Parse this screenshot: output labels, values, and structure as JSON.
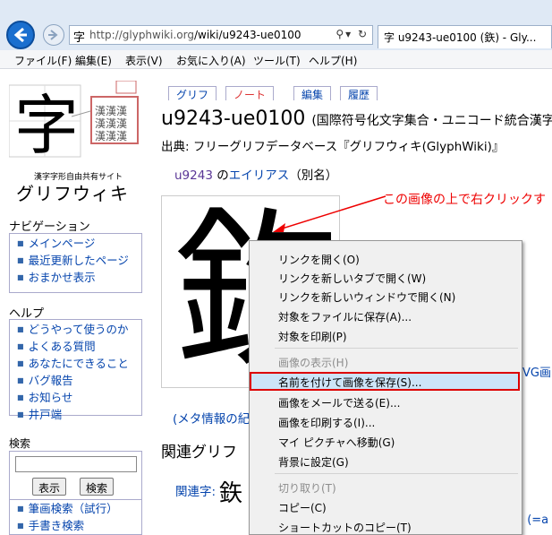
{
  "browser": {
    "url_host": "http://glyphwiki.org",
    "url_path": "/wiki/u9243-ue0100",
    "favicon": "字",
    "tab_title": "字 u9243-ue0100 (鉃) - Gly...",
    "menu": [
      "ファイル(F)",
      "編集(E)",
      "表示(V)",
      "お気に入り(A)",
      "ツール(T)",
      "ヘルプ(H)"
    ]
  },
  "logo": {
    "glyph": "字",
    "subtitle": "漢字字形自由共有サイト",
    "name": "グリフウィキ"
  },
  "page_tabs": [
    "グリフ",
    "ノート",
    "編集",
    "履歴"
  ],
  "sidebar": {
    "nav_heading": "ナビゲーション",
    "nav_items": [
      "メインページ",
      "最近更新したページ",
      "おまかせ表示"
    ],
    "help_heading": "ヘルプ",
    "help_items": [
      "どうやって使うのか",
      "よくある質問",
      "あなたにできること",
      "バグ報告",
      "お知らせ",
      "井戸端"
    ],
    "search_heading": "検索",
    "search_buttons": [
      "表示",
      "検索"
    ],
    "search_links": [
      "筆画検索（試行）",
      "手書き検索"
    ]
  },
  "main": {
    "title": "u9243-ue0100",
    "title_suffix": "(国際符号化文字集合・ユニコード統合漢字",
    "source": "出典: フリーグリフデータベース『グリフウィキ(GlyphWiki)』",
    "alias_code": "u9243",
    "alias_of": " の",
    "alias_link": "エイリアス",
    "alias_tail": "（別名）",
    "glyph": "鉃",
    "annotation": "この画像の上で右クリックす",
    "meta_link": "(メタ情報の紀",
    "related_heading": "関連グリフ",
    "related_label": "関連字:",
    "related_glyph": "鉃",
    "right_partial_1": "VG画",
    "right_partial_2": ") (=a"
  },
  "context_menu": {
    "items": [
      {
        "label": "リンクを開く(O)",
        "disabled": false
      },
      {
        "label": "リンクを新しいタブで開く(W)",
        "disabled": false
      },
      {
        "label": "リンクを新しいウィンドウで開く(N)",
        "disabled": false
      },
      {
        "label": "対象をファイルに保存(A)...",
        "disabled": false
      },
      {
        "label": "対象を印刷(P)",
        "disabled": false
      },
      {
        "label": "画像の表示(H)",
        "disabled": true
      },
      {
        "label": "名前を付けて画像を保存(S)...",
        "disabled": false
      },
      {
        "label": "画像をメールで送る(E)...",
        "disabled": false
      },
      {
        "label": "画像を印刷する(I)...",
        "disabled": false
      },
      {
        "label": "マイ ピクチャへ移動(G)",
        "disabled": false
      },
      {
        "label": "背景に設定(G)",
        "disabled": false
      },
      {
        "label": "切り取り(T)",
        "disabled": true
      },
      {
        "label": "コピー(C)",
        "disabled": false
      },
      {
        "label": "ショートカットのコピー(T)",
        "disabled": false
      }
    ]
  },
  "colors": {
    "accent_red": "#dd0000",
    "link": "#0645ad"
  }
}
